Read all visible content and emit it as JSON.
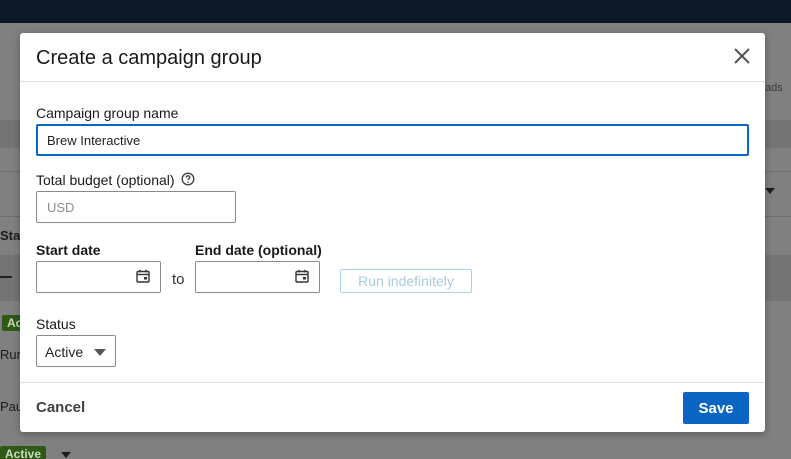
{
  "background": {
    "fragments": {
      "ads": "ads",
      "sta": "Sta",
      "run": "Run",
      "pau": "Pau",
      "active_partial": "Ac",
      "active_badge": "Active"
    }
  },
  "modal": {
    "title": "Create a campaign group",
    "close_icon": "close-icon",
    "name_label": "Campaign group name",
    "name_value": "Brew Interactive",
    "budget_label": "Total budget (optional)",
    "budget_placeholder": "USD",
    "help_icon": "question-circle-icon",
    "start_date_label": "Start date",
    "end_date_label": "End date (optional)",
    "to_text": "to",
    "calendar_icon": "calendar-icon",
    "run_indefinitely": "Run indefinitely",
    "status_label": "Status",
    "status_value": "Active",
    "cancel_label": "Cancel",
    "save_label": "Save"
  },
  "colors": {
    "primary": "#0a66c2",
    "run_disabled_border": "#a8d1ec",
    "active_badge": "#2e5a16",
    "topbar": "#0b1a26"
  }
}
